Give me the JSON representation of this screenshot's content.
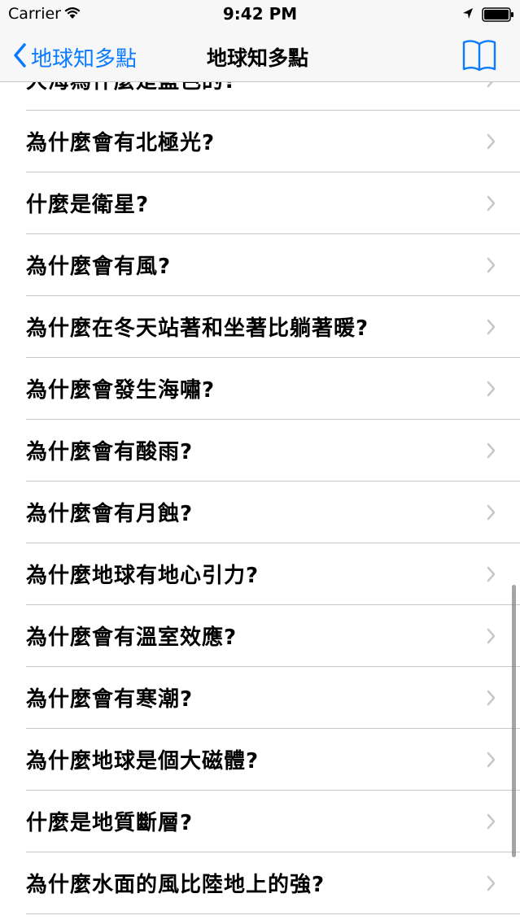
{
  "status_bar": {
    "carrier": "Carrier",
    "time": "9:42 PM",
    "icons": [
      "wifi-icon",
      "location-arrow-icon",
      "battery-icon"
    ]
  },
  "nav_bar": {
    "back_label": "地球知多點",
    "title": "地球知多點",
    "right_icon": "book-icon",
    "tint_color": "#0a7aff"
  },
  "list": {
    "items": [
      {
        "title": "大海為什麼是藍色的?"
      },
      {
        "title": "為什麼會有北極光?"
      },
      {
        "title": "什麼是衛星?"
      },
      {
        "title": "為什麼會有風?"
      },
      {
        "title": "為什麼在冬天站著和坐著比躺著暖?"
      },
      {
        "title": "為什麼會發生海嘯?"
      },
      {
        "title": "為什麼會有酸雨?"
      },
      {
        "title": "為什麼會有月蝕?"
      },
      {
        "title": "為什麼地球有地心引力?"
      },
      {
        "title": "為什麼會有溫室效應?"
      },
      {
        "title": "為什麼會有寒潮?"
      },
      {
        "title": "為什麼地球是個大磁體?"
      },
      {
        "title": "什麼是地質斷層?"
      },
      {
        "title": "為什麼水面的風比陸地上的強?"
      }
    ]
  }
}
